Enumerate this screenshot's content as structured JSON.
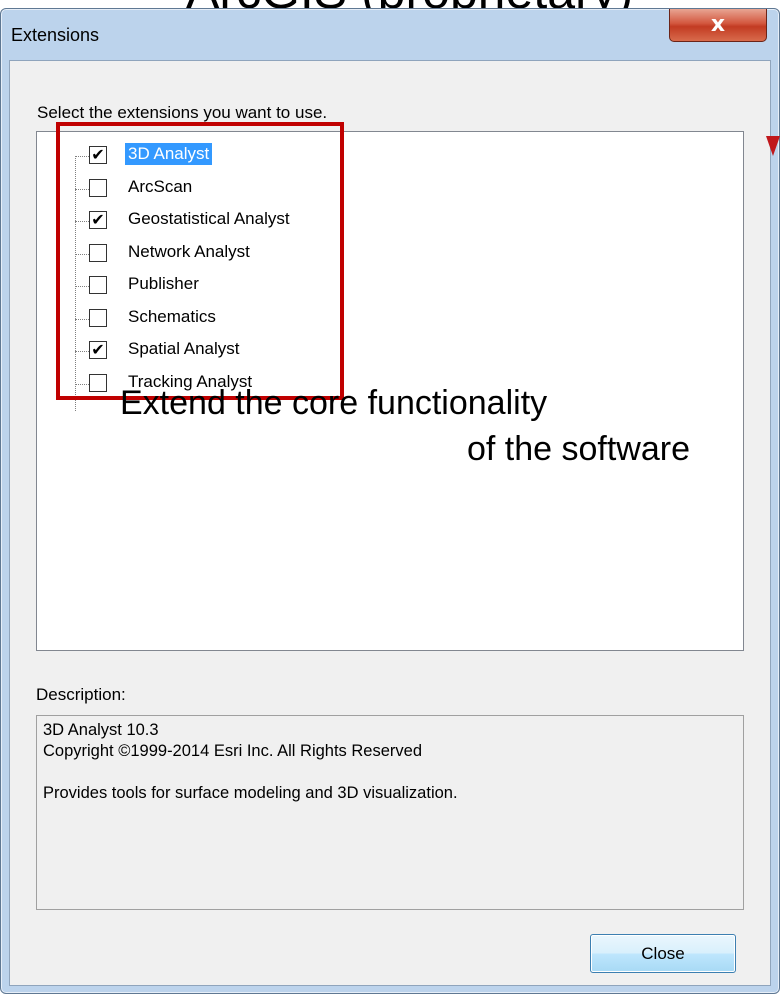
{
  "background": {
    "bullet_text": "ArcGIS (proprietary)"
  },
  "window": {
    "title": "Extensions",
    "close_glyph": "x",
    "select_label": "Select the extensions you want to use.",
    "extensions": [
      {
        "label": "3D Analyst",
        "checked": true,
        "selected": true
      },
      {
        "label": "ArcScan",
        "checked": false,
        "selected": false
      },
      {
        "label": "Geostatistical Analyst",
        "checked": true,
        "selected": false
      },
      {
        "label": "Network Analyst",
        "checked": false,
        "selected": false
      },
      {
        "label": "Publisher",
        "checked": false,
        "selected": false
      },
      {
        "label": "Schematics",
        "checked": false,
        "selected": false
      },
      {
        "label": "Spatial Analyst",
        "checked": true,
        "selected": false
      },
      {
        "label": "Tracking Analyst",
        "checked": false,
        "selected": false
      }
    ],
    "description_label": "Description:",
    "description_lines": [
      "3D Analyst 10.3",
      "Copyright ©1999-2014 Esri Inc. All Rights Reserved",
      "",
      "Provides tools for surface modeling and 3D visualization."
    ],
    "close_button_label": "Close"
  },
  "annotation": {
    "line1": "Extend the core functionality",
    "line2": "of the software"
  },
  "colors": {
    "highlight_border": "#c00000",
    "selection": "#3399ff",
    "arrow": "#c0171c"
  }
}
